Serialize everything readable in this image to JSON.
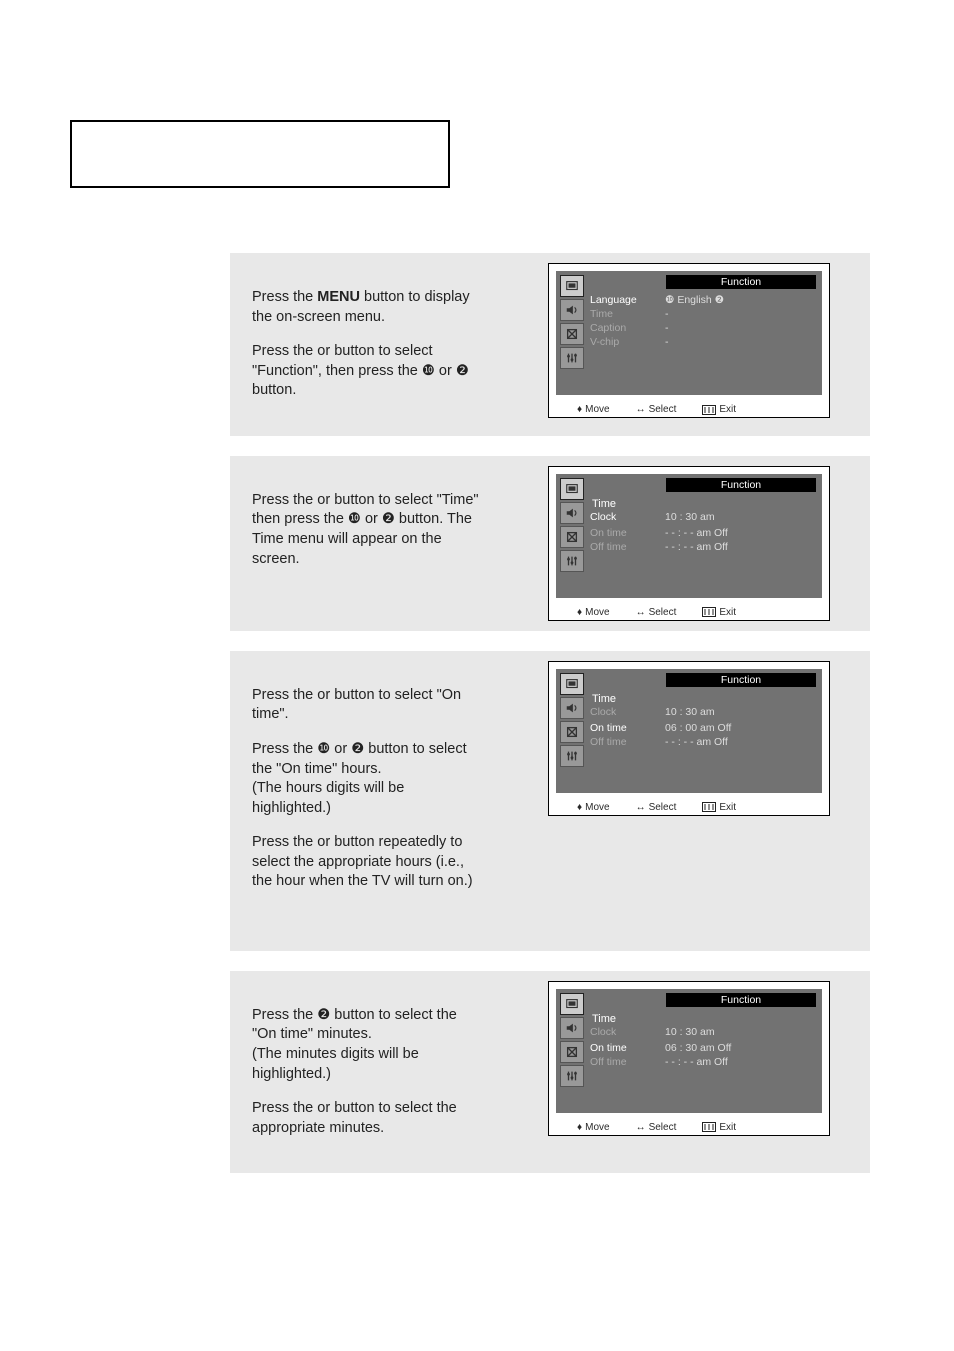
{
  "page": {
    "title_frame_empty": "",
    "steps": [
      {
        "para1_a": "Press the ",
        "para1_b": "MENU",
        "para1_c": " button to display the on-screen menu.",
        "para2": "Press the     or     button to select \"Function\", then press the  ❿  or  ❷  button."
      },
      {
        "para1": "Press the     or     button to select \"Time\" then press the  ❿  or  ❷  button. The Time menu will appear on the screen."
      },
      {
        "para1": "Press the     or     button to select \"On time\".",
        "para2": "Press the  ❿  or  ❷  button to select the \"On time\" hours.\n(The hours digits will be highlighted.)",
        "para3": "Press the     or     button repeatedly to select the appropriate hours (i.e., the hour when the TV will turn on.)"
      },
      {
        "para1": "Press the  ❷  button to select the \"On time\" minutes.\n(The minutes digits will be highlighted.)",
        "para2": "Press the     or     button to select the appropriate minutes."
      }
    ]
  },
  "osd_common": {
    "banner": "Function",
    "foot_move": "Move",
    "foot_select": "Select",
    "foot_exit": "Exit"
  },
  "osd1": {
    "rows": [
      {
        "label": "Language",
        "value": "❿   English          ❷",
        "hi": true
      },
      {
        "label": "Time",
        "value": "-",
        "hi": false
      },
      {
        "label": "Caption",
        "value": "-",
        "hi": false
      },
      {
        "label": "V-chip",
        "value": "-",
        "hi": false
      }
    ]
  },
  "osd2": {
    "title": "Time",
    "rows": [
      {
        "label": "Clock",
        "value": "10 : 30 am",
        "hi": true
      },
      {
        "label": "",
        "value": "",
        "hi": false
      },
      {
        "label": "On time",
        "value": "- -  :  - - am   Off",
        "hi": false
      },
      {
        "label": "Off time",
        "value": "- -  :  - - am   Off",
        "hi": false
      }
    ]
  },
  "osd3": {
    "title": "Time",
    "rows": [
      {
        "label": "Clock",
        "value": "10 : 30 am",
        "hi": false
      },
      {
        "label": "",
        "value": "",
        "hi": false
      },
      {
        "label": "On time",
        "value": "06 : 00 am   Off",
        "hi": true
      },
      {
        "label": "Off time",
        "value": "- -  :  - - am   Off",
        "hi": false
      }
    ]
  },
  "osd4": {
    "title": "Time",
    "rows": [
      {
        "label": "Clock",
        "value": "10 : 30 am",
        "hi": false
      },
      {
        "label": "",
        "value": "",
        "hi": false
      },
      {
        "label": "On time",
        "value": "06 : 30 am   Off",
        "hi": true
      },
      {
        "label": "Off time",
        "value": "- -  :  - - am   Off",
        "hi": false
      }
    ]
  }
}
